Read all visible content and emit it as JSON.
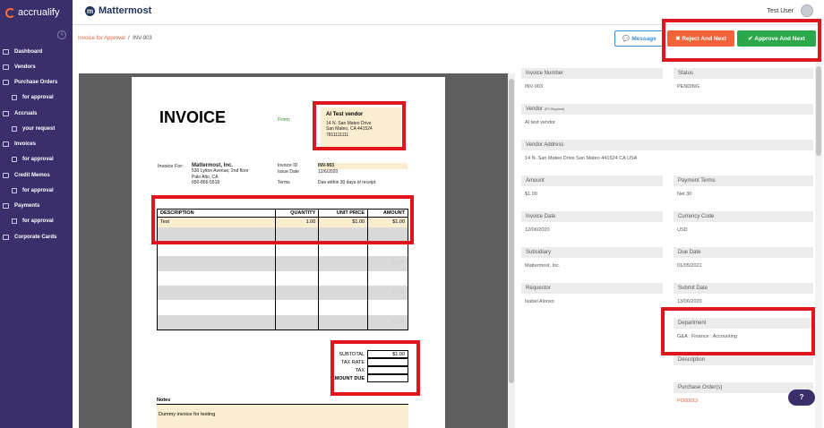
{
  "sidebar": {
    "brand": "accrualify",
    "items": [
      {
        "label": "Dashboard",
        "icon": "home-icon"
      },
      {
        "label": "Vendors",
        "icon": "vendors-icon"
      },
      {
        "label": "Purchase Orders",
        "icon": "purchase-orders-icon"
      },
      {
        "label": "for approval",
        "icon": "approval-icon",
        "sub": true
      },
      {
        "label": "Accruals",
        "icon": "accruals-icon"
      },
      {
        "label": "your request",
        "icon": "request-icon",
        "sub": true
      },
      {
        "label": "Invoices",
        "icon": "invoices-icon"
      },
      {
        "label": "for approval",
        "icon": "approval-icon",
        "sub": true
      },
      {
        "label": "Credit Memos",
        "icon": "credit-memos-icon"
      },
      {
        "label": "for approval",
        "icon": "approval-icon",
        "sub": true
      },
      {
        "label": "Payments",
        "icon": "payments-icon"
      },
      {
        "label": "for approval",
        "icon": "approval-icon",
        "sub": true
      },
      {
        "label": "Corporate Cards",
        "icon": "cards-icon"
      }
    ]
  },
  "topbar": {
    "app": "Mattermost",
    "user": "Test User"
  },
  "breadcrumb": {
    "parent": "Invoice for Approval",
    "sep": "/",
    "current": "INV-903"
  },
  "actions": {
    "message": "Message",
    "reject": "Reject And Next",
    "approve": "Approve And Next"
  },
  "invoice": {
    "title": "INVOICE",
    "from_label": "From:",
    "vendor_name": "AI Test vendor",
    "vendor_addr1": "14 N. San Mateo Drive",
    "vendor_addr2": "San Mateo, CA 441524",
    "vendor_phone": "7811111111",
    "bill_label": "Invoice For:",
    "bill_name": "Mattermost, Inc.",
    "bill_addr1": "530 Lytton Avenue, 2nd floor",
    "bill_addr2": "Palo Alto, CA",
    "bill_phone": "650-866-5518",
    "id_label": "Invoice ID",
    "id_value": "INV-903",
    "date_label": "Issue Date",
    "date_value": "12/6/2020",
    "terms_label": "Terms",
    "terms_value": "Due within 30 days of receipt",
    "columns": [
      "DESCRIPTION",
      "QUANTITY",
      "UNIT PRICE",
      "AMOUNT"
    ],
    "line": {
      "desc": "Test",
      "qty": "1.00",
      "price": "$1.00",
      "amount": "$1.00"
    },
    "blank_amount": "$0.00",
    "subtotal_label": "SUBTOTAL",
    "subtotal_value": "$1.00",
    "taxrate_label": "TAX RATE",
    "tax_label": "TAX",
    "amountdue_label": "AMOUNT DUE",
    "notes_label": "Notes",
    "notes_text": "Dummy invoice for testing"
  },
  "details": {
    "invoice_number": {
      "label": "Invoice Number",
      "value": "INV-903"
    },
    "status": {
      "label": "Status",
      "value": "PENDING"
    },
    "vendor": {
      "label": "Vendor",
      "note": "(PO Required)",
      "value": "AI test vendor"
    },
    "vendor_address": {
      "label": "Vendor Address",
      "value": "14 N. San Mateo Drive San Mateo 441524 CA USA"
    },
    "amount": {
      "label": "Amount",
      "value": "$1.00"
    },
    "payment_terms": {
      "label": "Payment Terms",
      "value": "Net 30"
    },
    "invoice_date": {
      "label": "Invoice Date",
      "value": "12/06/2020"
    },
    "currency": {
      "label": "Currency Code",
      "value": "USD"
    },
    "subsidiary": {
      "label": "Subsidiary",
      "value": "Mattermost, Inc."
    },
    "due_date": {
      "label": "Due Date",
      "value": "01/05/2021"
    },
    "requestor": {
      "label": "Requestor",
      "value": "Isabel Alonso"
    },
    "submit_date": {
      "label": "Submit Date",
      "value": "13/06/2020"
    },
    "department": {
      "label": "Department",
      "value": "G&A : Finance : Accounting"
    },
    "description": {
      "label": "Description",
      "value": ""
    },
    "purchase_orders": {
      "label": "Purchase Order(s)",
      "value": "PO00013"
    }
  },
  "help": "?",
  "colors": {
    "sidebar": "#3a2e6b",
    "reject": "#f4623a",
    "approve": "#2aa84a",
    "highlight": "#e0161f",
    "link": "#e0633b"
  }
}
